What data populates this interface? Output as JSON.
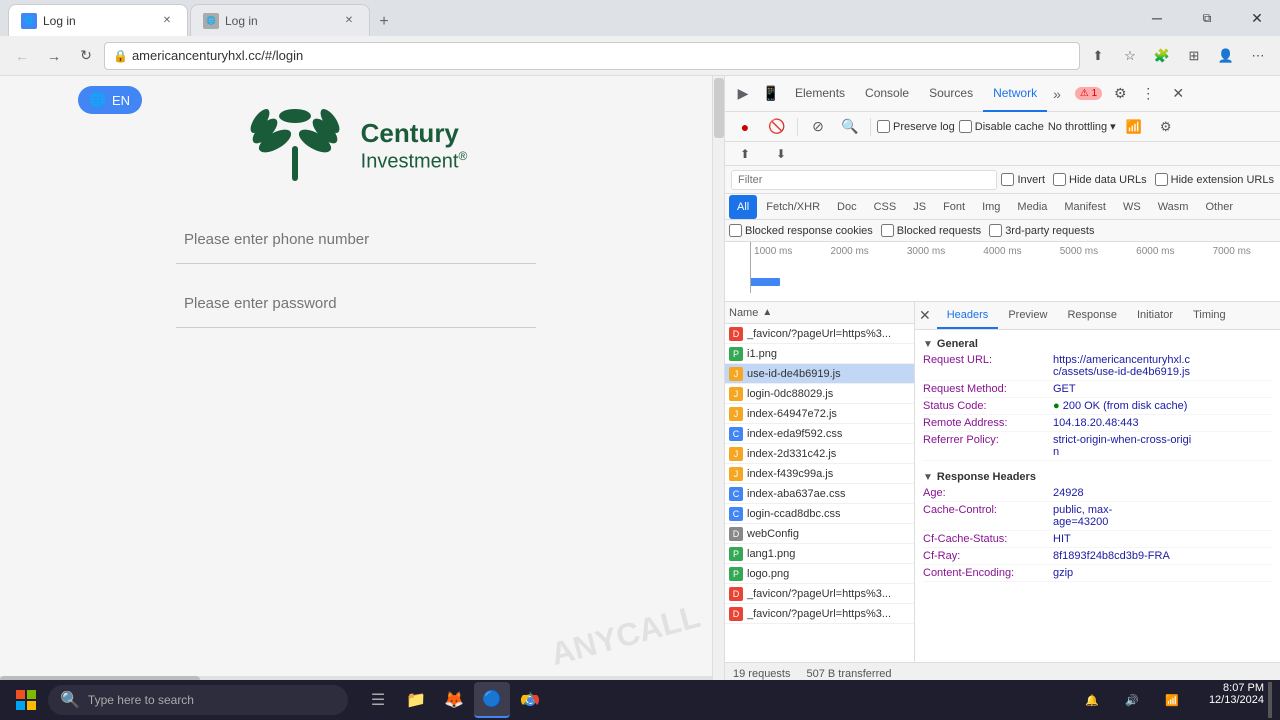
{
  "browser": {
    "tabs": [
      {
        "id": "tab1",
        "title": "Log in",
        "favicon": "globe",
        "active": true,
        "url": "americancenturyhxl.cc/#/login"
      },
      {
        "id": "tab2",
        "title": "Log in",
        "favicon": "globe",
        "active": false,
        "url": ""
      }
    ],
    "address": "americancenturyhxl.cc/#/login",
    "new_tab_label": "+",
    "window_controls": [
      "⊟",
      "❐",
      "✕"
    ]
  },
  "page": {
    "logo_text1": "Century",
    "logo_text2": "Investment",
    "logo_reg": "®",
    "phone_placeholder": "Please enter phone number",
    "password_placeholder": "Please enter password",
    "translate_btn": "EN"
  },
  "devtools": {
    "tabs": [
      "Elements",
      "Console",
      "Sources",
      "Network"
    ],
    "active_tab": "Network",
    "badge": "⚠ 1",
    "toolbar": {
      "record": "●",
      "clear": "🚫",
      "filter": "⊘",
      "search": "🔍",
      "preserve_log": "Preserve log",
      "disable_cache": "Disable cache",
      "throttling": "No throttling",
      "wifi": "📶"
    },
    "filter_placeholder": "Filter",
    "filter_options": [
      "Invert",
      "Hide data URLs",
      "Hide extension URLs"
    ],
    "type_tabs": [
      "All",
      "Fetch/XHR",
      "Doc",
      "CSS",
      "JS",
      "Font",
      "Img",
      "Media",
      "Manifest",
      "WS",
      "Wasm",
      "Other"
    ],
    "active_type": "All",
    "blocked_cookies": "Blocked response cookies",
    "blocked_requests": "Blocked requests",
    "third_party": "3rd-party requests",
    "timeline_labels": [
      "1000 ms",
      "2000 ms",
      "3000 ms",
      "4000 ms",
      "5000 ms",
      "6000 ms",
      "7000 ms"
    ],
    "name_col": "Name",
    "files": [
      {
        "name": "_favicon/?pageUrl=https%3...",
        "type": "doc",
        "selected": false
      },
      {
        "name": "i1.png",
        "type": "png",
        "selected": false
      },
      {
        "name": "use-id-de4b6919.js",
        "type": "js",
        "selected": true
      },
      {
        "name": "login-0dc88029.js",
        "type": "js",
        "selected": false
      },
      {
        "name": "index-64947e72.js",
        "type": "js",
        "selected": false
      },
      {
        "name": "index-eda9f592.css",
        "type": "css",
        "selected": false
      },
      {
        "name": "index-2d331c42.js",
        "type": "js",
        "selected": false
      },
      {
        "name": "index-f439c99a.js",
        "type": "js",
        "selected": false
      },
      {
        "name": "index-aba637ae.css",
        "type": "css",
        "selected": false
      },
      {
        "name": "login-ccad8dbc.css",
        "type": "css",
        "selected": false
      },
      {
        "name": "webConfig",
        "type": "doc",
        "selected": false
      },
      {
        "name": "lang1.png",
        "type": "png",
        "selected": false
      },
      {
        "name": "logo.png",
        "type": "png",
        "selected": false
      },
      {
        "name": "_favicon/?pageUrl=https%3...",
        "type": "doc",
        "selected": false
      },
      {
        "name": "_favicon/?pageUrl=https%3...",
        "type": "doc",
        "selected": false
      }
    ],
    "status_bar": {
      "requests": "19 requests",
      "transferred": "507 B transferred"
    },
    "details": {
      "tabs": [
        "Headers",
        "Preview",
        "Response",
        "Initiator",
        "Timing"
      ],
      "active_tab": "Headers",
      "general_section": "General",
      "general_open": true,
      "request_url_key": "Request URL:",
      "request_url_val": "https://americancenturyhxl.cc/assets/use-id-de4b6919.js",
      "request_method_key": "Request Method:",
      "request_method_val": "GET",
      "status_code_key": "Status Code:",
      "status_code_val": "200 OK (from disk cache)",
      "remote_address_key": "Remote Address:",
      "remote_address_val": "104.18.20.48:443",
      "referrer_policy_key": "Referrer Policy:",
      "referrer_policy_val": "strict-origin-when-cross-origin",
      "response_headers_section": "Response Headers",
      "age_key": "Age:",
      "age_val": "24928",
      "cache_control_key": "Cache-Control:",
      "cache_control_val": "public, max-age=43200",
      "cf_cache_status_key": "Cf-Cache-Status:",
      "cf_cache_status_val": "HIT",
      "cf_ray_key": "Cf-Ray:",
      "cf_ray_val": "8f1893f24b8cd3b9-FRA",
      "content_encoding_key": "Content-Encoding:",
      "content_encoding_val": "gzip"
    }
  },
  "taskbar": {
    "search_placeholder": "Type here to search",
    "time": "8:07 PM",
    "date": "12/13/2024",
    "apps": [
      "⊞",
      "🔍",
      "☰",
      "📁",
      "🦊",
      "🔵"
    ]
  }
}
